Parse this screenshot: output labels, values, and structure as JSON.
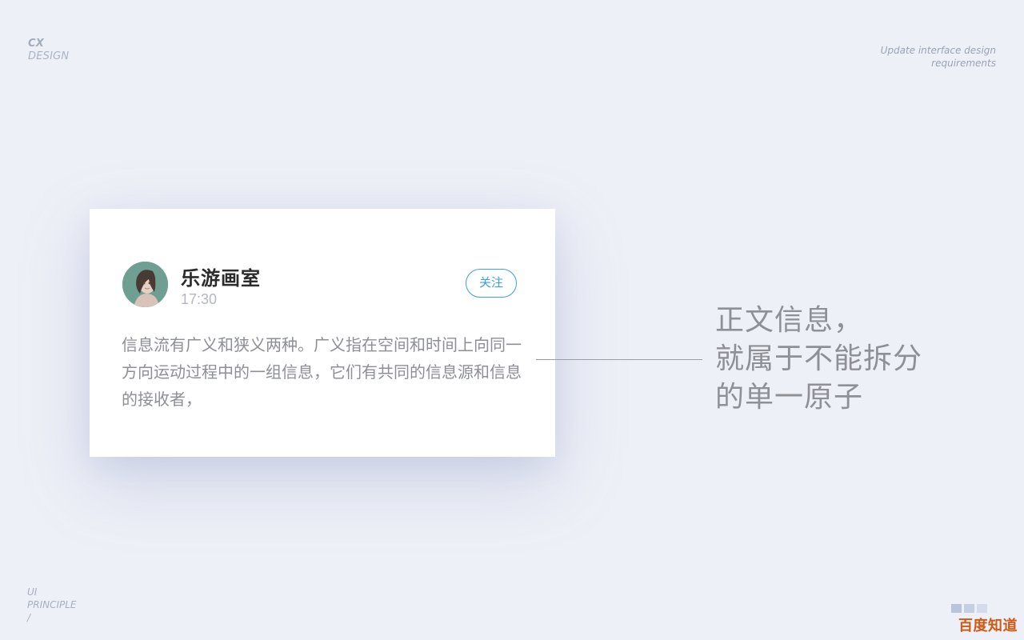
{
  "brand": {
    "line1": "CX",
    "line2": "DESIGN"
  },
  "header_note": {
    "line1": "Update interface design",
    "line2": "requirements"
  },
  "footer_label": {
    "line1": "UI",
    "line2": "PRINCIPLE",
    "line3": "/"
  },
  "watermark": {
    "text": "百度知道"
  },
  "card": {
    "name": "乐游画室",
    "time": "17:30",
    "follow_label": "关注",
    "body": "信息流有广义和狭义两种。广义指在空间和时间上向同一方向运动过程中的一组信息，它们有共同的信息源和信息的接收者，"
  },
  "annotation": {
    "line1": "正文信息，",
    "line2": "就属于不能拆分",
    "line3": "的单一原子"
  },
  "colors": {
    "background": "#eef0f7",
    "accent": "#3d9fe5",
    "watermark": "#cd5b16"
  }
}
